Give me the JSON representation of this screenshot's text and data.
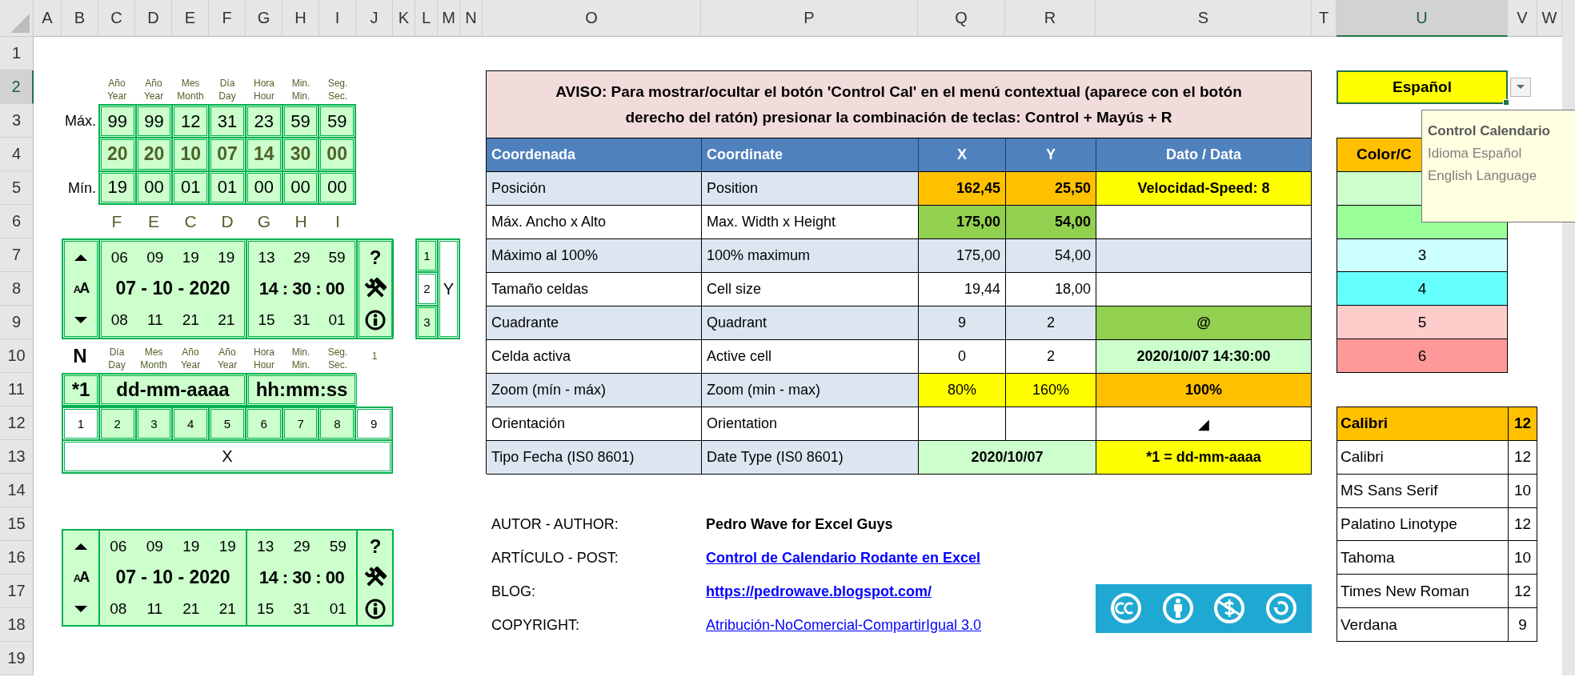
{
  "sheet": {
    "columns": [
      {
        "label": "A",
        "selected": false
      },
      {
        "label": "B",
        "selected": false
      },
      {
        "label": "C",
        "selected": false
      },
      {
        "label": "D",
        "selected": false
      },
      {
        "label": "E",
        "selected": false
      },
      {
        "label": "F",
        "selected": false
      },
      {
        "label": "G",
        "selected": false
      },
      {
        "label": "H",
        "selected": false
      },
      {
        "label": "I",
        "selected": false
      },
      {
        "label": "J",
        "selected": false
      },
      {
        "label": "K",
        "selected": false
      },
      {
        "label": "L",
        "selected": false
      },
      {
        "label": "M",
        "selected": false
      },
      {
        "label": "N",
        "selected": false
      },
      {
        "label": "O",
        "selected": false
      },
      {
        "label": "P",
        "selected": false
      },
      {
        "label": "Q",
        "selected": false
      },
      {
        "label": "R",
        "selected": false
      },
      {
        "label": "S",
        "selected": false
      },
      {
        "label": "T",
        "selected": false
      },
      {
        "label": "U",
        "selected": true
      },
      {
        "label": "V",
        "selected": false
      },
      {
        "label": "W",
        "selected": false
      }
    ],
    "rows": [
      {
        "label": "1",
        "selected": false
      },
      {
        "label": "2",
        "selected": true
      },
      {
        "label": "3",
        "selected": false
      },
      {
        "label": "4",
        "selected": false
      },
      {
        "label": "5",
        "selected": false
      },
      {
        "label": "6",
        "selected": false
      },
      {
        "label": "7",
        "selected": false
      },
      {
        "label": "8",
        "selected": false
      },
      {
        "label": "9",
        "selected": false
      },
      {
        "label": "10",
        "selected": false
      },
      {
        "label": "11",
        "selected": false
      },
      {
        "label": "12",
        "selected": false
      },
      {
        "label": "13",
        "selected": false
      },
      {
        "label": "14",
        "selected": false
      },
      {
        "label": "15",
        "selected": false
      },
      {
        "label": "16",
        "selected": false
      },
      {
        "label": "17",
        "selected": false
      },
      {
        "label": "18",
        "selected": false
      },
      {
        "label": "19",
        "selected": false
      }
    ]
  },
  "limits": {
    "captions": [
      {
        "es": "Año",
        "en": "Year"
      },
      {
        "es": "Año",
        "en": "Year"
      },
      {
        "es": "Mes",
        "en": "Month"
      },
      {
        "es": "Día",
        "en": "Day"
      },
      {
        "es": "Hora",
        "en": "Hour"
      },
      {
        "es": "Min.",
        "en": "Min."
      },
      {
        "es": "Seg.",
        "en": "Sec."
      }
    ],
    "max_label": "Máx.",
    "max": [
      "99",
      "99",
      "12",
      "31",
      "23",
      "59",
      "59"
    ],
    "current": [
      "20",
      "20",
      "10",
      "07",
      "14",
      "30",
      "00"
    ],
    "min_label": "Mín.",
    "min": [
      "19",
      "00",
      "01",
      "01",
      "00",
      "00",
      "00"
    ]
  },
  "column_letters": [
    "F",
    "E",
    "C",
    "D",
    "G",
    "H",
    "I"
  ],
  "calendars": [
    {
      "font_label": "AA",
      "date_before": [
        "06",
        "09",
        "19",
        "19"
      ],
      "date": "07 - 10 - 2020",
      "date_after": [
        "08",
        "11",
        "21",
        "21"
      ],
      "time_before": [
        "13",
        "29",
        "59"
      ],
      "time": "14 : 30 : 00",
      "time_after": [
        "15",
        "31",
        "01"
      ],
      "help": "?"
    },
    {
      "font_label": "AA",
      "date_before": [
        "06",
        "09",
        "19",
        "19"
      ],
      "date": "07 - 10 - 2020",
      "date_after": [
        "08",
        "11",
        "21",
        "21"
      ],
      "time_before": [
        "13",
        "29",
        "59"
      ],
      "time": "14 : 30 : 00",
      "time_after": [
        "15",
        "31",
        "01"
      ],
      "help": "?"
    }
  ],
  "y_selector": {
    "items": [
      {
        "label": "1",
        "shaded": true
      },
      {
        "label": "2",
        "shaded": false
      },
      {
        "label": "3",
        "shaded": true
      }
    ],
    "label": "Y"
  },
  "format": {
    "n_label": "N",
    "captions": [
      {
        "es": "Día",
        "en": "Day"
      },
      {
        "es": "Mes",
        "en": "Month"
      },
      {
        "es": "Año",
        "en": "Year"
      },
      {
        "es": "Año",
        "en": "Year"
      },
      {
        "es": "Hora",
        "en": "Hour"
      },
      {
        "es": "Min.",
        "en": "Min."
      },
      {
        "es": "Seg.",
        "en": "Sec."
      }
    ],
    "note": "1",
    "cells": [
      "*1",
      "dd-mm-aaaa",
      "hh:mm:ss"
    ]
  },
  "x_selector": {
    "items": [
      {
        "label": "1",
        "shaded": false
      },
      {
        "label": "2",
        "shaded": true
      },
      {
        "label": "3",
        "shaded": true
      },
      {
        "label": "4",
        "shaded": true
      },
      {
        "label": "5",
        "shaded": true
      },
      {
        "label": "6",
        "shaded": true
      },
      {
        "label": "7",
        "shaded": true
      },
      {
        "label": "8",
        "shaded": true
      },
      {
        "label": "9",
        "shaded": false
      }
    ],
    "label": "X"
  },
  "info_table": {
    "notice": "AVISO: Para mostrar/ocultar el botón 'Control Cal' en el menú contextual (aparece con el botón derecho del ratón) presionar la combinación de teclas: Control + Mayús + R",
    "columns": [
      "Coordenada",
      "Coordinate",
      "X",
      "Y",
      "Dato / Data"
    ],
    "rows": [
      {
        "kind": "measure",
        "banded": true,
        "cells": [
          {
            "text": "Posición"
          },
          {
            "text": "Position"
          },
          {
            "text": "162,45",
            "color": "#ffc000",
            "bold": true
          },
          {
            "text": "25,50",
            "color": "#ffc000",
            "bold": true
          },
          {
            "text": "Velocidad-Speed: 8",
            "color": "#ffff00",
            "bold": true
          }
        ]
      },
      {
        "kind": "measure",
        "banded": false,
        "cells": [
          {
            "text": "Máx. Ancho x Alto"
          },
          {
            "text": "Max. Width x Height"
          },
          {
            "text": "175,00",
            "color": "#92d050",
            "bold": true
          },
          {
            "text": "54,00",
            "color": "#92d050",
            "bold": true
          },
          {
            "kind": "blank"
          }
        ]
      },
      {
        "kind": "measure",
        "banded": true,
        "cells": [
          {
            "text": "Máximo al 100%"
          },
          {
            "text": "100% maximum"
          },
          {
            "text": "175,00",
            "bold": false
          },
          {
            "text": "54,00",
            "bold": false
          },
          {
            "kind": "blank"
          }
        ]
      },
      {
        "kind": "measure",
        "banded": false,
        "cells": [
          {
            "text": "Tamaño celdas"
          },
          {
            "text": "Cell size"
          },
          {
            "text": "19,44",
            "bold": false
          },
          {
            "text": "18,00",
            "bold": false
          },
          {
            "kind": "blank"
          }
        ]
      },
      {
        "kind": "index",
        "banded": true,
        "cells": [
          {
            "text": "Cuadrante"
          },
          {
            "text": "Quadrant"
          },
          {
            "text": "9",
            "bold": false
          },
          {
            "text": "2",
            "bold": false
          },
          {
            "text": "@",
            "color": "#92d050",
            "bold": true
          }
        ]
      },
      {
        "kind": "index",
        "banded": false,
        "cells": [
          {
            "text": "Celda activa"
          },
          {
            "text": "Active cell"
          },
          {
            "text": "0",
            "bold": false
          },
          {
            "text": "2",
            "bold": false
          },
          {
            "text": "2020/10/07 14:30:00",
            "color": "#ccffcc",
            "bold": true
          }
        ]
      },
      {
        "kind": "index",
        "banded": true,
        "cells": [
          {
            "text": "Zoom (mín - máx)"
          },
          {
            "text": "Zoom (min - max)"
          },
          {
            "text": "80%",
            "color": "#ffff00",
            "bold": false
          },
          {
            "text": "160%",
            "color": "#ffff00",
            "bold": false
          },
          {
            "text": "100%",
            "color": "#ffc000",
            "bold": true
          }
        ]
      },
      {
        "kind": "index",
        "banded": false,
        "cells": [
          {
            "text": "Orientación"
          },
          {
            "text": "Orientation"
          },
          {
            "kind": "blank"
          },
          {
            "kind": "blank"
          },
          {
            "text": "◢",
            "bold": false
          }
        ]
      },
      {
        "kind": "index",
        "banded": true,
        "cells": [
          {
            "text": "Tipo Fecha (IS0 8601)"
          },
          {
            "text": "Date Type (IS0 8601)"
          },
          {
            "text": "2020/10/07",
            "kind": "merged",
            "color": "#ccffcc",
            "bold": true
          },
          {
            "kind": "continuation"
          },
          {
            "text": "*1 = dd-mm-aaaa",
            "color": "#ffff00",
            "bold": true
          }
        ]
      }
    ]
  },
  "credits": [
    {
      "label": "AUTOR - AUTHOR:",
      "value": "Pedro Wave for Excel Guys",
      "kind": "bold"
    },
    {
      "label": "ARTÍCULO - POST:",
      "value": "Control de Calendario Rodante en Excel",
      "kind": "bold_link"
    },
    {
      "label": "BLOG:",
      "value": "https://pedrowave.blogspot.com/",
      "kind": "bold_link"
    },
    {
      "label": "COPYRIGHT:",
      "value": "Atribución-NoComercial-CompartirIgual 3.0",
      "kind": "link"
    }
  ],
  "language": {
    "value": "Español",
    "tooltip": {
      "title": "Control Calendario",
      "options": [
        "Idioma Español",
        "English Language"
      ]
    }
  },
  "colors": {
    "header": "Color/C",
    "items": [
      {
        "color": "#ccffcc"
      },
      {
        "color": "#99ff99"
      },
      {
        "label": "3",
        "color": "#ccffff"
      },
      {
        "label": "4",
        "color": "#66ffff"
      },
      {
        "label": "5",
        "color": "#ffcccc"
      },
      {
        "label": "6",
        "color": "#ff9999"
      }
    ]
  },
  "fonts": {
    "header": {
      "name": "Calibri",
      "size": "12"
    },
    "items": [
      {
        "name": "Calibri",
        "size": "12"
      },
      {
        "name": "MS Sans Serif",
        "size": "10"
      },
      {
        "name": "Palatino Linotype",
        "size": "12"
      },
      {
        "name": "Tahoma",
        "size": "10"
      },
      {
        "name": "Times New Roman",
        "size": "12"
      },
      {
        "name": "Verdana",
        "size": "9"
      }
    ]
  }
}
